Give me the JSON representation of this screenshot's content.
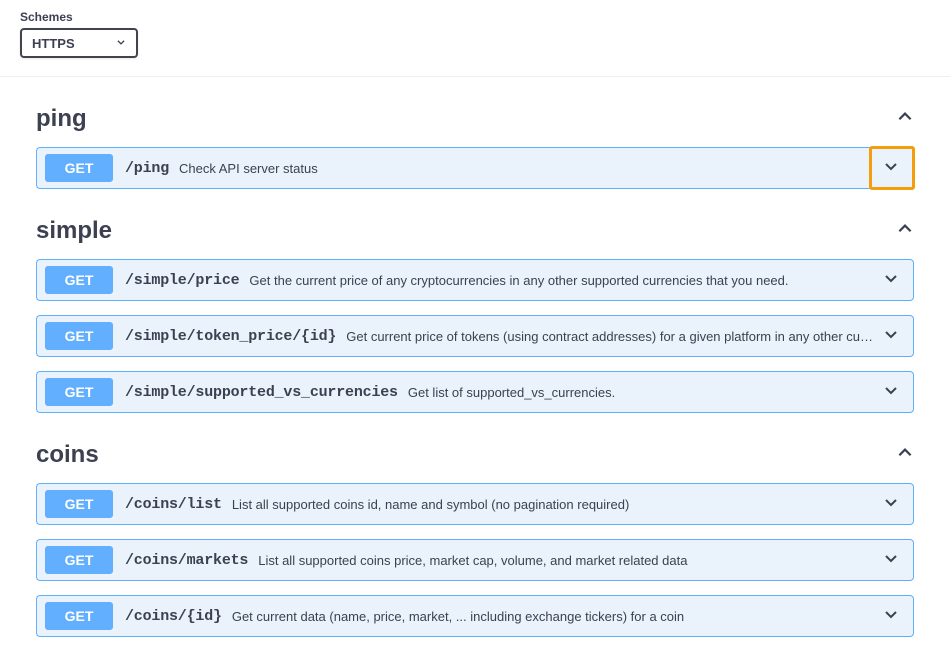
{
  "schemes": {
    "label": "Schemes",
    "selected": "HTTPS"
  },
  "tags": [
    {
      "name": "ping",
      "operations": [
        {
          "method": "GET",
          "path": "/ping",
          "desc": "Check API server status",
          "highlighted": true
        }
      ]
    },
    {
      "name": "simple",
      "operations": [
        {
          "method": "GET",
          "path": "/simple/price",
          "desc": "Get the current price of any cryptocurrencies in any other supported currencies that you need."
        },
        {
          "method": "GET",
          "path": "/simple/token_price/{id}",
          "desc": "Get current price of tokens (using contract addresses) for a given platform in any other currency that you need."
        },
        {
          "method": "GET",
          "path": "/simple/supported_vs_currencies",
          "desc": "Get list of supported_vs_currencies."
        }
      ]
    },
    {
      "name": "coins",
      "operations": [
        {
          "method": "GET",
          "path": "/coins/list",
          "desc": "List all supported coins id, name and symbol (no pagination required)"
        },
        {
          "method": "GET",
          "path": "/coins/markets",
          "desc": "List all supported coins price, market cap, volume, and market related data"
        },
        {
          "method": "GET",
          "path": "/coins/{id}",
          "desc": "Get current data (name, price, market, ... including exchange tickers) for a coin"
        }
      ]
    }
  ]
}
